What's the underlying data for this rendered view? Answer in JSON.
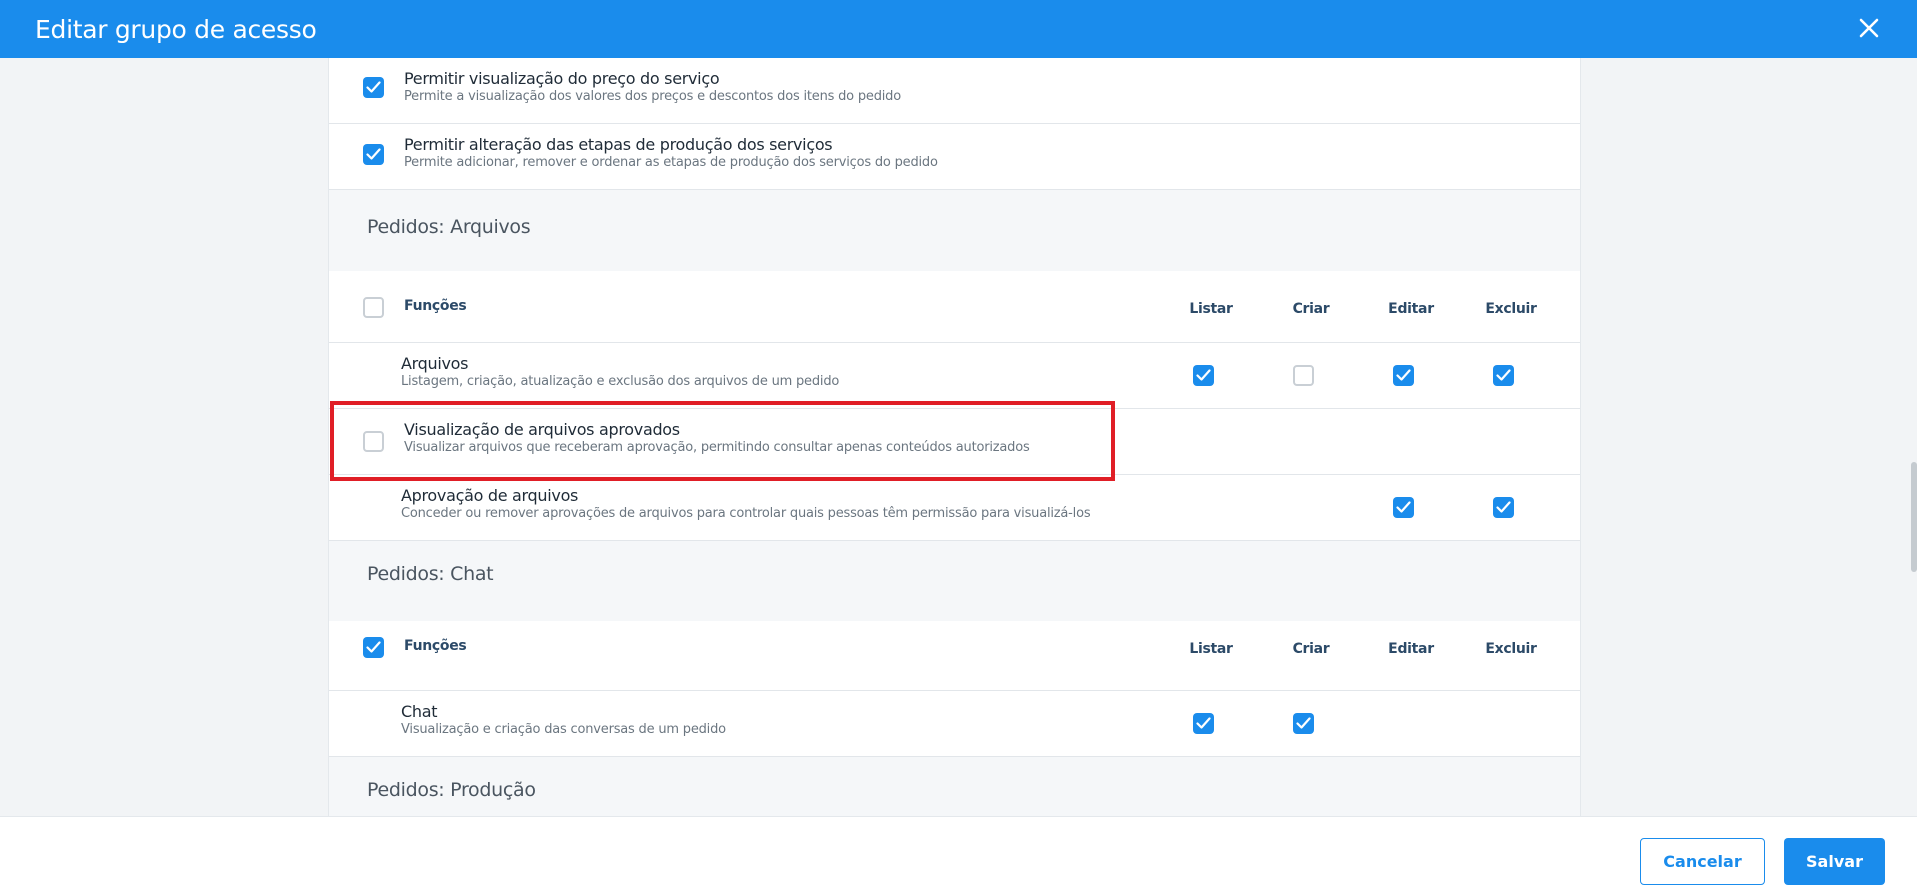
{
  "header": {
    "title": "Editar grupo de acesso",
    "close_icon": "close-icon"
  },
  "top_items": [
    {
      "title": "Permitir visualização do preço do serviço",
      "desc": "Permite a visualização dos valores dos preços e descontos dos itens do pedido",
      "checked": true
    },
    {
      "title": "Permitir alteração das etapas de produção dos serviços",
      "desc": "Permite adicionar, remover e ordenar as etapas de produção dos serviços do pedido",
      "checked": true
    }
  ],
  "sections": [
    {
      "title": "Pedidos: Arquivos",
      "functions_label": "Funções",
      "functions_checked": false,
      "columns": [
        "Listar",
        "Criar",
        "Editar",
        "Excluir"
      ],
      "items": [
        {
          "title": "Arquivos",
          "desc": "Listagem, criação, atualização e exclusão dos arquivos de um pedido",
          "perms": [
            true,
            false,
            true,
            true
          ]
        },
        {
          "title": "Visualização de arquivos aprovados",
          "desc": "Visualizar arquivos que receberam aprovação, permitindo consultar apenas conteúdos autorizados",
          "checked": false
        },
        {
          "title": "Aprovação de arquivos",
          "desc": "Conceder ou remover aprovações de arquivos para controlar quais pessoas têm permissão para visualizá-los",
          "perms": [
            null,
            null,
            true,
            true
          ]
        }
      ]
    },
    {
      "title": "Pedidos: Chat",
      "functions_label": "Funções",
      "functions_checked": true,
      "columns": [
        "Listar",
        "Criar",
        "Editar",
        "Excluir"
      ],
      "items": [
        {
          "title": "Chat",
          "desc": "Visualização e criação das conversas de um pedido",
          "perms": [
            true,
            true,
            null,
            null
          ]
        }
      ]
    },
    {
      "title": "Pedidos: Produção"
    }
  ],
  "footer": {
    "cancel_label": "Cancelar",
    "save_label": "Salvar"
  },
  "colors": {
    "accent": "#1a8cec",
    "highlight": "#e01e26"
  }
}
